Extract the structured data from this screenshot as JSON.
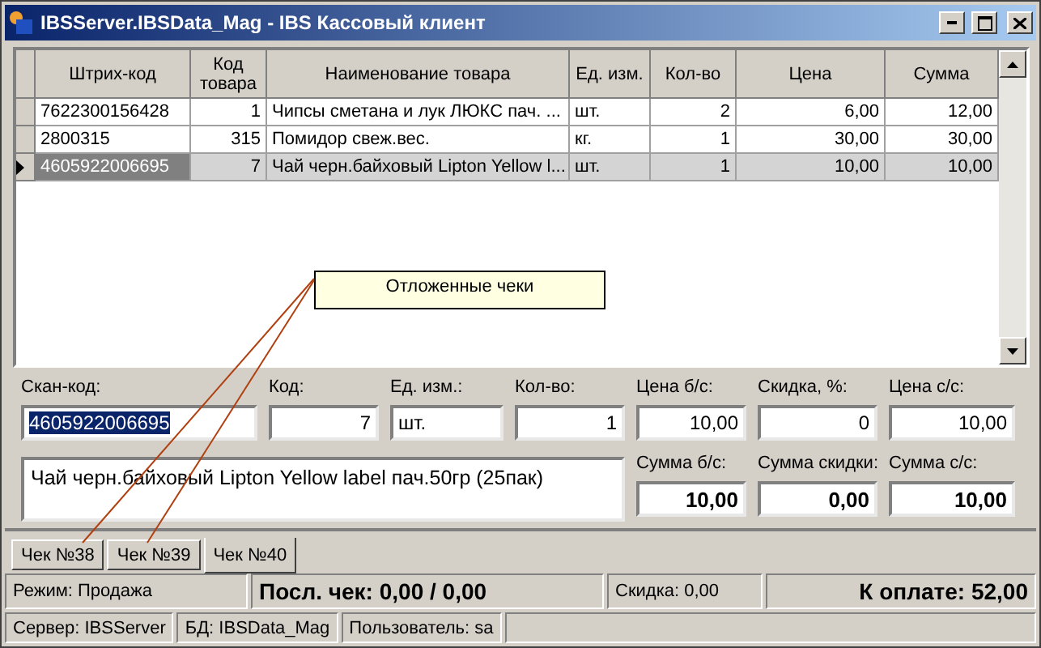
{
  "window": {
    "title": "IBSServer.IBSData_Mag - IBS Кассовый клиент"
  },
  "table": {
    "columns": [
      {
        "label": "Штрих-код",
        "numeric": false
      },
      {
        "label": "Код товара",
        "numeric": true
      },
      {
        "label": "Наименование товара",
        "numeric": false
      },
      {
        "label": "Ед. изм.",
        "numeric": false
      },
      {
        "label": "Кол-во",
        "numeric": true
      },
      {
        "label": "Цена",
        "numeric": true
      },
      {
        "label": "Сумма",
        "numeric": true
      }
    ],
    "rows": [
      {
        "cells": [
          "7622300156428",
          "1",
          "Чипсы сметана и лук ЛЮКС пач. ...",
          "шт.",
          "2",
          "6,00",
          "12,00"
        ],
        "selected": false
      },
      {
        "cells": [
          "2800315",
          "315",
          "Помидор свеж.вес.",
          "кг.",
          "1",
          "30,00",
          "30,00"
        ],
        "selected": false
      },
      {
        "cells": [
          "4605922006695",
          "7",
          "Чай черн.байховый Lipton Yellow l...",
          "шт.",
          "1",
          "10,00",
          "10,00"
        ],
        "selected": true
      }
    ]
  },
  "callout": {
    "text": "Отложенные чеки"
  },
  "fields": [
    {
      "label": "Скан-код:",
      "value": "4605922006695",
      "numeric": false,
      "text_selected": true
    },
    {
      "label": "Код:",
      "value": "7",
      "numeric": true,
      "text_selected": false
    },
    {
      "label": "Ед. изм.:",
      "value": "шт.",
      "numeric": false,
      "text_selected": false
    },
    {
      "label": "Кол-во:",
      "value": "1",
      "numeric": true,
      "text_selected": false
    },
    {
      "label": "Цена б/с:",
      "value": "10,00",
      "numeric": true,
      "text_selected": false
    },
    {
      "label": "Скидка, %:",
      "value": "0",
      "numeric": true,
      "text_selected": false
    },
    {
      "label": "Цена с/с:",
      "value": "10,00",
      "numeric": true,
      "text_selected": false
    }
  ],
  "description": "Чай черн.байховый Lipton Yellow label пач.50гр (25пак)",
  "totals": [
    {
      "label": "Сумма б/с:",
      "value": "10,00"
    },
    {
      "label": "Сумма скидки:",
      "value": "0,00"
    },
    {
      "label": "Сумма с/с:",
      "value": "10,00"
    }
  ],
  "tabs": [
    {
      "label": "Чек №38",
      "selected": false
    },
    {
      "label": "Чек №39",
      "selected": false
    },
    {
      "label": "Чек №40",
      "selected": true
    }
  ],
  "status_bar": {
    "mode": "Режим: Продажа",
    "last_check": "Посл. чек: 0,00 / 0,00",
    "discount": "Скидка: 0,00",
    "to_pay": "К оплате: 52,00"
  },
  "connection_bar": [
    "Сервер: IBSServer",
    "БД: IBSData_Mag",
    "Пользователь: sa"
  ]
}
